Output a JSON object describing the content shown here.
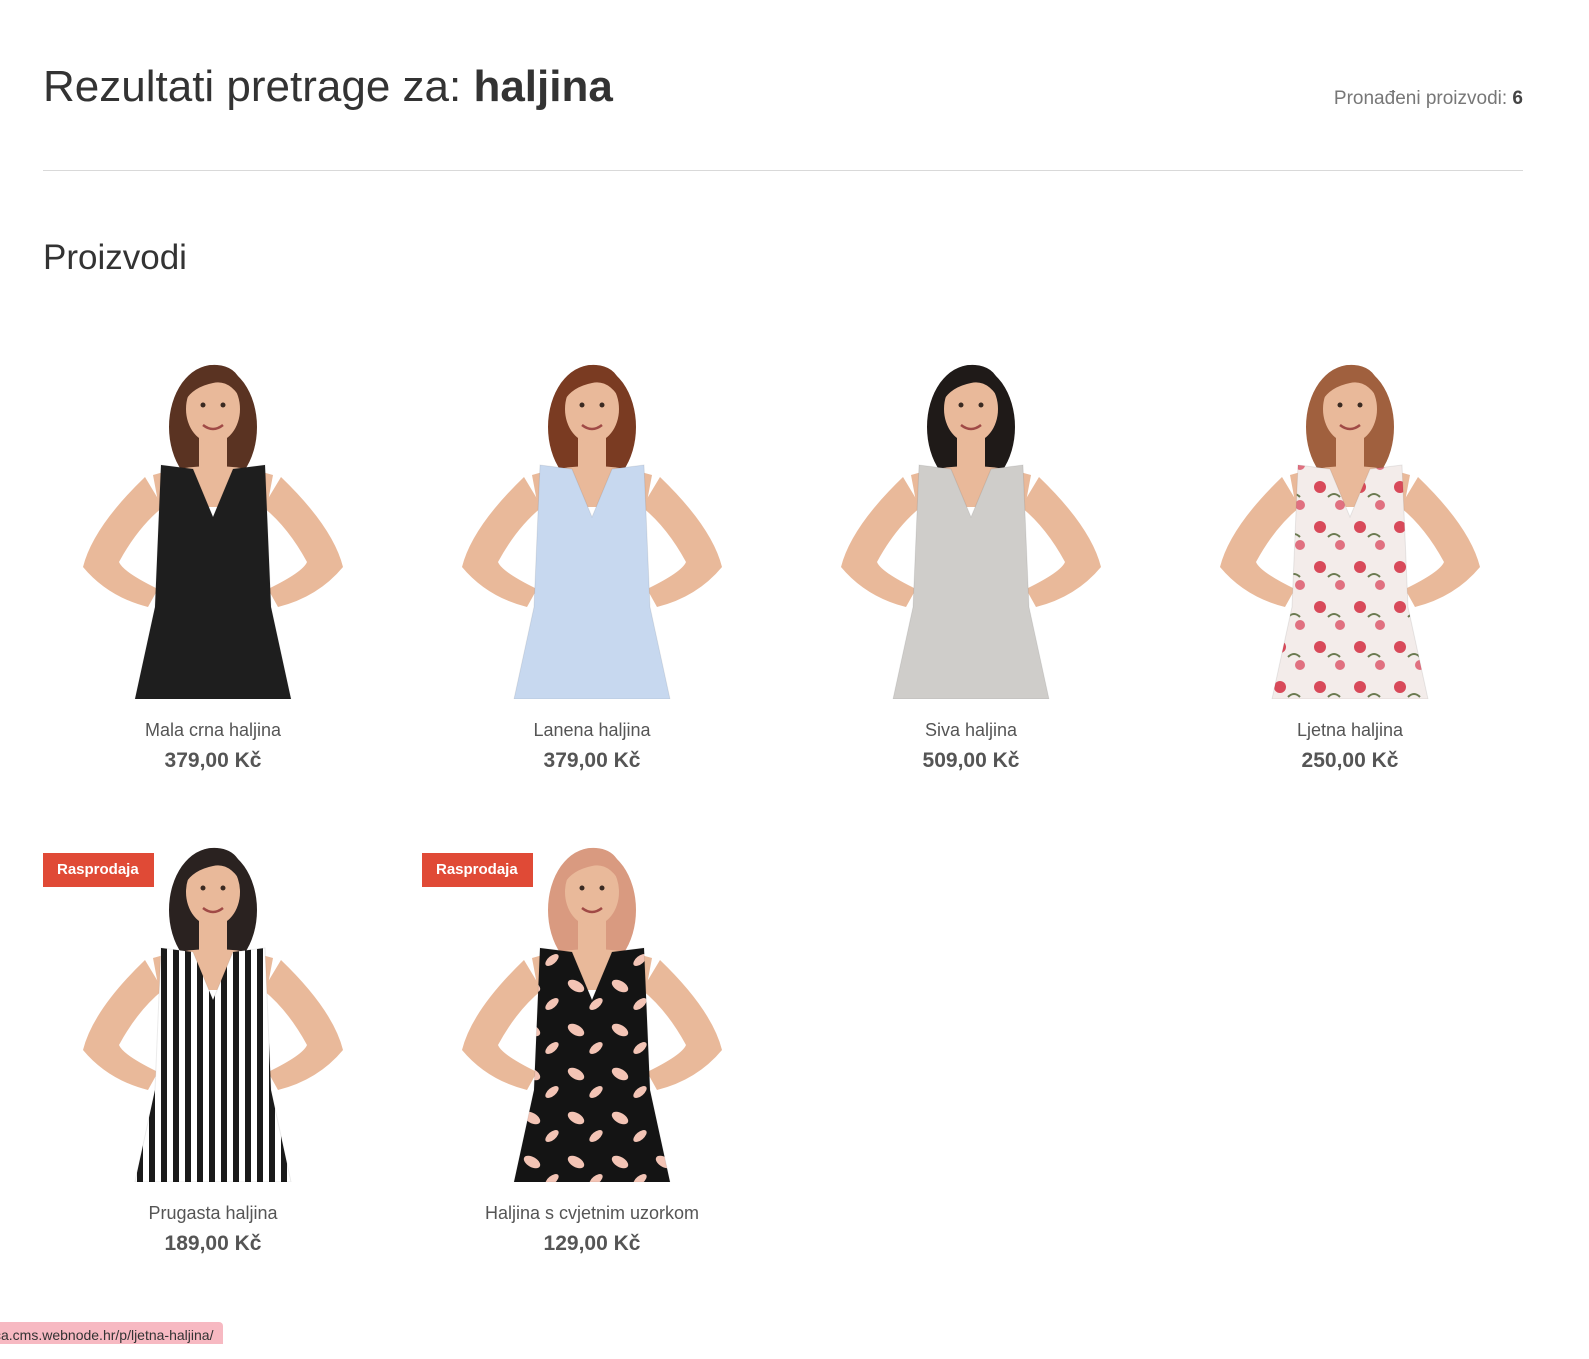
{
  "header": {
    "title_prefix": "Rezultati pretrage za: ",
    "query": "haljina",
    "count_label": "Pronađeni proizvodi: ",
    "count_value": "6"
  },
  "section": {
    "title": "Proizvodi"
  },
  "products": [
    {
      "name": "Mala crna haljina",
      "price": "379,00 Kč",
      "badge": "",
      "dress_color": "#1e1e1e",
      "hair_color": "#5a3322"
    },
    {
      "name": "Lanena haljina",
      "price": "379,00 Kč",
      "badge": "",
      "dress_color": "#c7d8ef",
      "hair_color": "#7a3b22"
    },
    {
      "name": "Siva haljina",
      "price": "509,00 Kč",
      "badge": "",
      "dress_color": "#cfcdca",
      "hair_color": "#1f1a18"
    },
    {
      "name": "Ljetna haljina",
      "price": "250,00 Kč",
      "badge": "",
      "dress_color": "#f3ecea",
      "hair_color": "#a0603e"
    },
    {
      "name": "Prugasta haljina",
      "price": "189,00 Kč",
      "badge": "Rasprodaja",
      "dress_color": "#ffffff",
      "hair_color": "#2a2220"
    },
    {
      "name": "Haljina s cvjetnim uzorkom",
      "price": "129,00 Kč",
      "badge": "Rasprodaja",
      "dress_color": "#141414",
      "hair_color": "#d99a80"
    }
  ],
  "status_bar": {
    "url": "ca.cms.webnode.hr/p/ljetna-haljina/"
  },
  "colors": {
    "badge": "#e04a36",
    "text": "#333333",
    "muted": "#777777",
    "divider": "#d9d9d9",
    "status_bar": "#f7b9c2"
  }
}
